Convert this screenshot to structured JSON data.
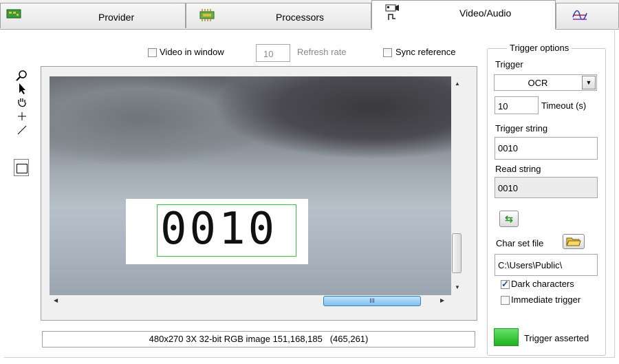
{
  "tabs": [
    {
      "label": "Provider",
      "icon": "circuit-board-icon"
    },
    {
      "label": "Processors",
      "icon": "chip-icon"
    },
    {
      "label": "Video/Audio",
      "icon": "camera-audio-icon"
    },
    {
      "label": "",
      "icon": "waveform-icon"
    }
  ],
  "video_options": {
    "video_in_window_label": "Video in window",
    "video_in_window_checked": false,
    "refresh_value": "10",
    "refresh_label": "Refresh rate",
    "sync_reference_label": "Sync reference",
    "sync_reference_checked": false
  },
  "tools": [
    "zoom-icon",
    "pointer-icon",
    "pan-hand-icon",
    "crosshair-icon",
    "line-icon",
    "rectangle-icon"
  ],
  "video": {
    "ocr_text": "0010",
    "scrollbar_grip": "III"
  },
  "status_text": "480x270 3X 32-bit RGB image 151,168,185   (465,261)",
  "trigger_options": {
    "group_title": "Trigger options",
    "trigger_label": "Trigger",
    "trigger_value": "OCR",
    "timeout_value": "10",
    "timeout_label": "Timeout (s)",
    "trigger_string_label": "Trigger string",
    "trigger_string_value": "0010",
    "read_string_label": "Read string",
    "read_string_value": "0010",
    "char_set_file_label": "Char set file",
    "char_set_file_value": "C:\\Users\\Public\\",
    "dark_characters_label": "Dark characters",
    "dark_characters_checked": true,
    "immediate_trigger_label": "Immediate trigger",
    "immediate_trigger_checked": false,
    "trigger_asserted_label": "Trigger asserted",
    "indicator_color": "#33cc33"
  }
}
